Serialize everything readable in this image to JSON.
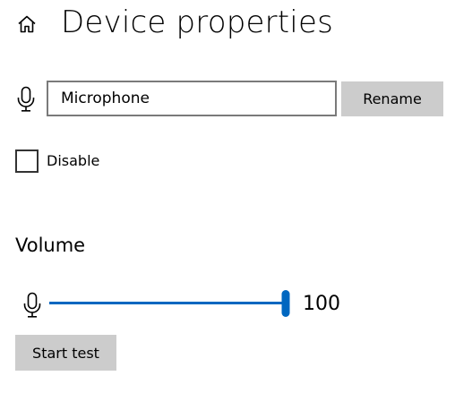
{
  "header": {
    "title": "Device properties",
    "home_icon": "home-icon"
  },
  "device": {
    "icon": "microphone-icon",
    "name_value": "Microphone",
    "rename_label": "Rename"
  },
  "disable": {
    "label": "Disable",
    "checked": false
  },
  "volume": {
    "heading": "Volume",
    "icon": "microphone-icon",
    "value": "100",
    "level": 1.0,
    "start_test_label": "Start test"
  },
  "colors": {
    "accent": "#0067c0",
    "button_bg": "#cccccc",
    "input_border": "#7a7a7a"
  }
}
